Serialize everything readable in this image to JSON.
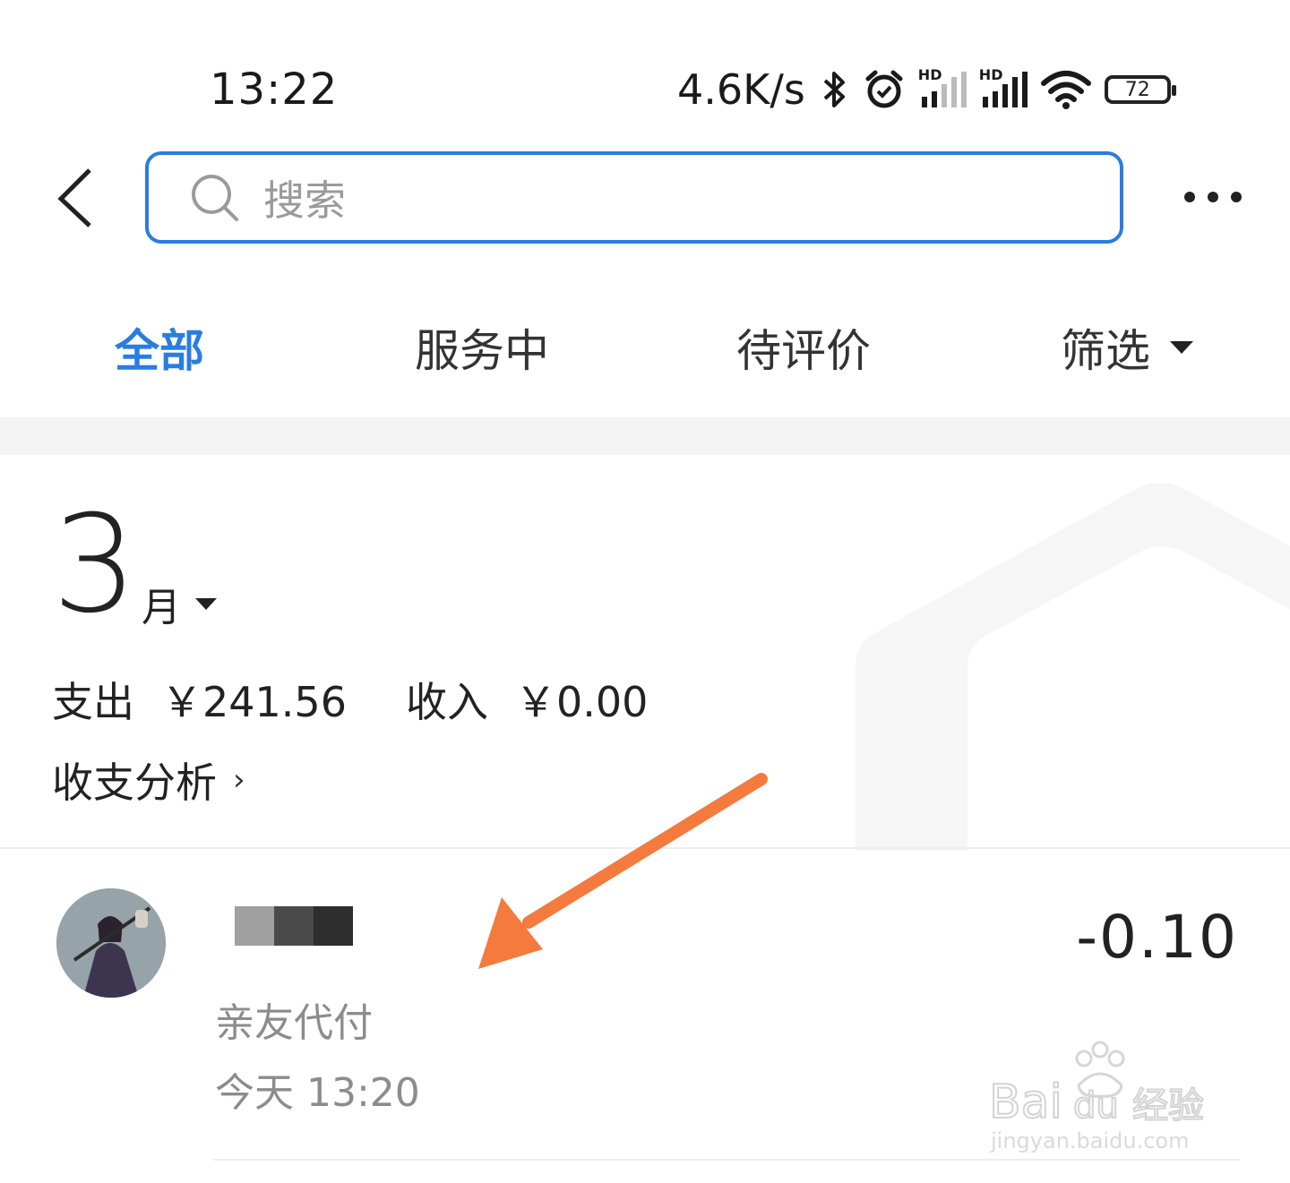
{
  "status_bar": {
    "time": "13:22",
    "net_speed": "4.6K/s",
    "signal_label": "HD",
    "battery": "72"
  },
  "search": {
    "placeholder": "搜索"
  },
  "tabs": [
    {
      "label": "全部",
      "active": true
    },
    {
      "label": "服务中",
      "active": false
    },
    {
      "label": "待评价",
      "active": false
    },
    {
      "label": "筛选",
      "active": false
    }
  ],
  "summary": {
    "month_number": "3",
    "month_unit": "月",
    "expense_label": "支出",
    "expense_value": "￥241.56",
    "income_label": "收入",
    "income_value": "￥0.00",
    "analysis_label": "收支分析",
    "analysis_chevron": "›"
  },
  "transaction": {
    "type": "亲友代付",
    "time": "今天  13:20",
    "amount": "-0.10"
  },
  "watermark": {
    "brand": "Baidu经验",
    "url": "jingyan.baidu.com"
  },
  "colors": {
    "accent": "#2a7de0",
    "arrow": "#f57a3e",
    "muted": "#8c8c8c"
  }
}
